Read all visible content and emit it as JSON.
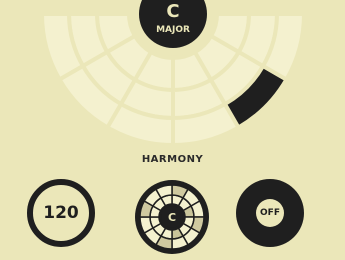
{
  "key": {
    "note": "C",
    "mode": "MAJOR"
  },
  "section_label": "HARMONY",
  "harmony_wheel": {
    "rings": 3,
    "segments_per_ring": 6,
    "selected": {
      "ring": 2,
      "segment": 4
    }
  },
  "controls": {
    "tempo": "120",
    "mini_wheel_note": "C",
    "toggle": "OFF"
  },
  "colors": {
    "background": "#ebe7b9",
    "cell": "#f4f1cf",
    "stroke": "#d7d3a4",
    "selected": "#1f1f1f",
    "dark": "#1f1f1f"
  }
}
